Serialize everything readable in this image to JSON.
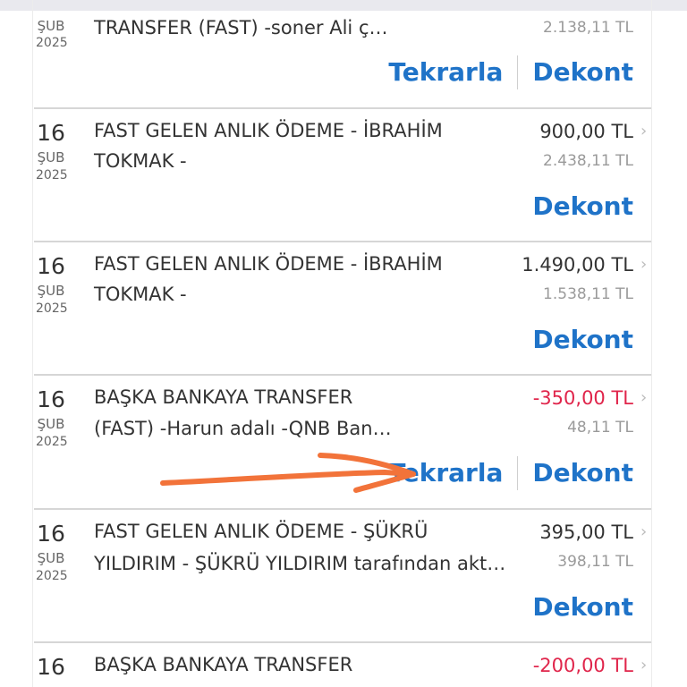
{
  "colors": {
    "link": "#1f73c8",
    "negative_amount": "#e0254b",
    "annotation_arrow": "#f2733a",
    "separator": "#d6d6d6"
  },
  "actions": {
    "repeat_label": "Tekrarla",
    "receipt_label": "Dekont"
  },
  "transactions": [
    {
      "day": "",
      "month": "ŞUB",
      "year": "2025",
      "description_line1": "TRANSFER (FAST) -soner Ali ç…",
      "description_line2": "",
      "amount": "",
      "balance": "2.138,11 TL"
    },
    {
      "day": "16",
      "month": "ŞUB",
      "year": "2025",
      "description_line1": "FAST GELEN ANLIK ÖDEME - İBRAHİM",
      "description_line2": "TOKMAK -",
      "amount": "900,00 TL",
      "balance": "2.438,11 TL"
    },
    {
      "day": "16",
      "month": "ŞUB",
      "year": "2025",
      "description_line1": "FAST GELEN ANLIK ÖDEME - İBRAHİM",
      "description_line2": "TOKMAK -",
      "amount": "1.490,00 TL",
      "balance": "1.538,11 TL"
    },
    {
      "day": "16",
      "month": "ŞUB",
      "year": "2025",
      "description_line1": "BAŞKA BANKAYA TRANSFER",
      "description_line2": "(FAST) -Harun adalı -QNB Ban…",
      "amount": "-350,00 TL",
      "balance": "48,11 TL"
    },
    {
      "day": "16",
      "month": "ŞUB",
      "year": "2025",
      "description_line1": "FAST GELEN ANLIK ÖDEME - ŞÜKRÜ",
      "description_line2": "YILDIRIM - ŞÜKRÜ YILDIRIM tarafından akt…",
      "amount": "395,00 TL",
      "balance": "398,11 TL"
    },
    {
      "day": "16",
      "month": "",
      "year": "",
      "description_line1": "BAŞKA BANKAYA TRANSFER",
      "description_line2": "",
      "amount": "-200,00 TL",
      "balance": ""
    }
  ]
}
